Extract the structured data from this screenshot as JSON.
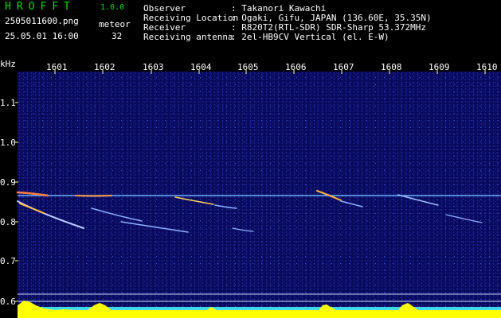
{
  "app": {
    "title": "HROFFT",
    "version": "1.0.0"
  },
  "file_name": "2505011600.png",
  "datetime": "25.05.01 16:00",
  "meteor_label": "meteor",
  "meteor_count": "32",
  "info": [
    {
      "key": "Observer",
      "value": ": Takanori Kawachi"
    },
    {
      "key": "Receiving Location",
      "value": ": Ogaki, Gifu, JAPAN (136.60E, 35.35N)"
    },
    {
      "key": "Receiver",
      "value": ": R820T2(RTL-SDR) SDR-Sharp 53.372MHz"
    },
    {
      "key": "Receiving antenna",
      "value": ": 2el-HB9CV Vertical (el. E-W)"
    }
  ],
  "axis": {
    "y_unit": "kHz",
    "y_ticks": [
      "1.1",
      "1.0",
      "0.9",
      "0.8",
      "0.7",
      "0.6"
    ],
    "x_ticks": [
      "1601",
      "1602",
      "1603",
      "1604",
      "1605",
      "1606",
      "1607",
      "1608",
      "1609",
      "1610"
    ]
  },
  "colors": {
    "accent": "#00e000",
    "carrier": "#6fb0ff",
    "level": "#ffff00",
    "background": "#0a0a5c"
  }
}
